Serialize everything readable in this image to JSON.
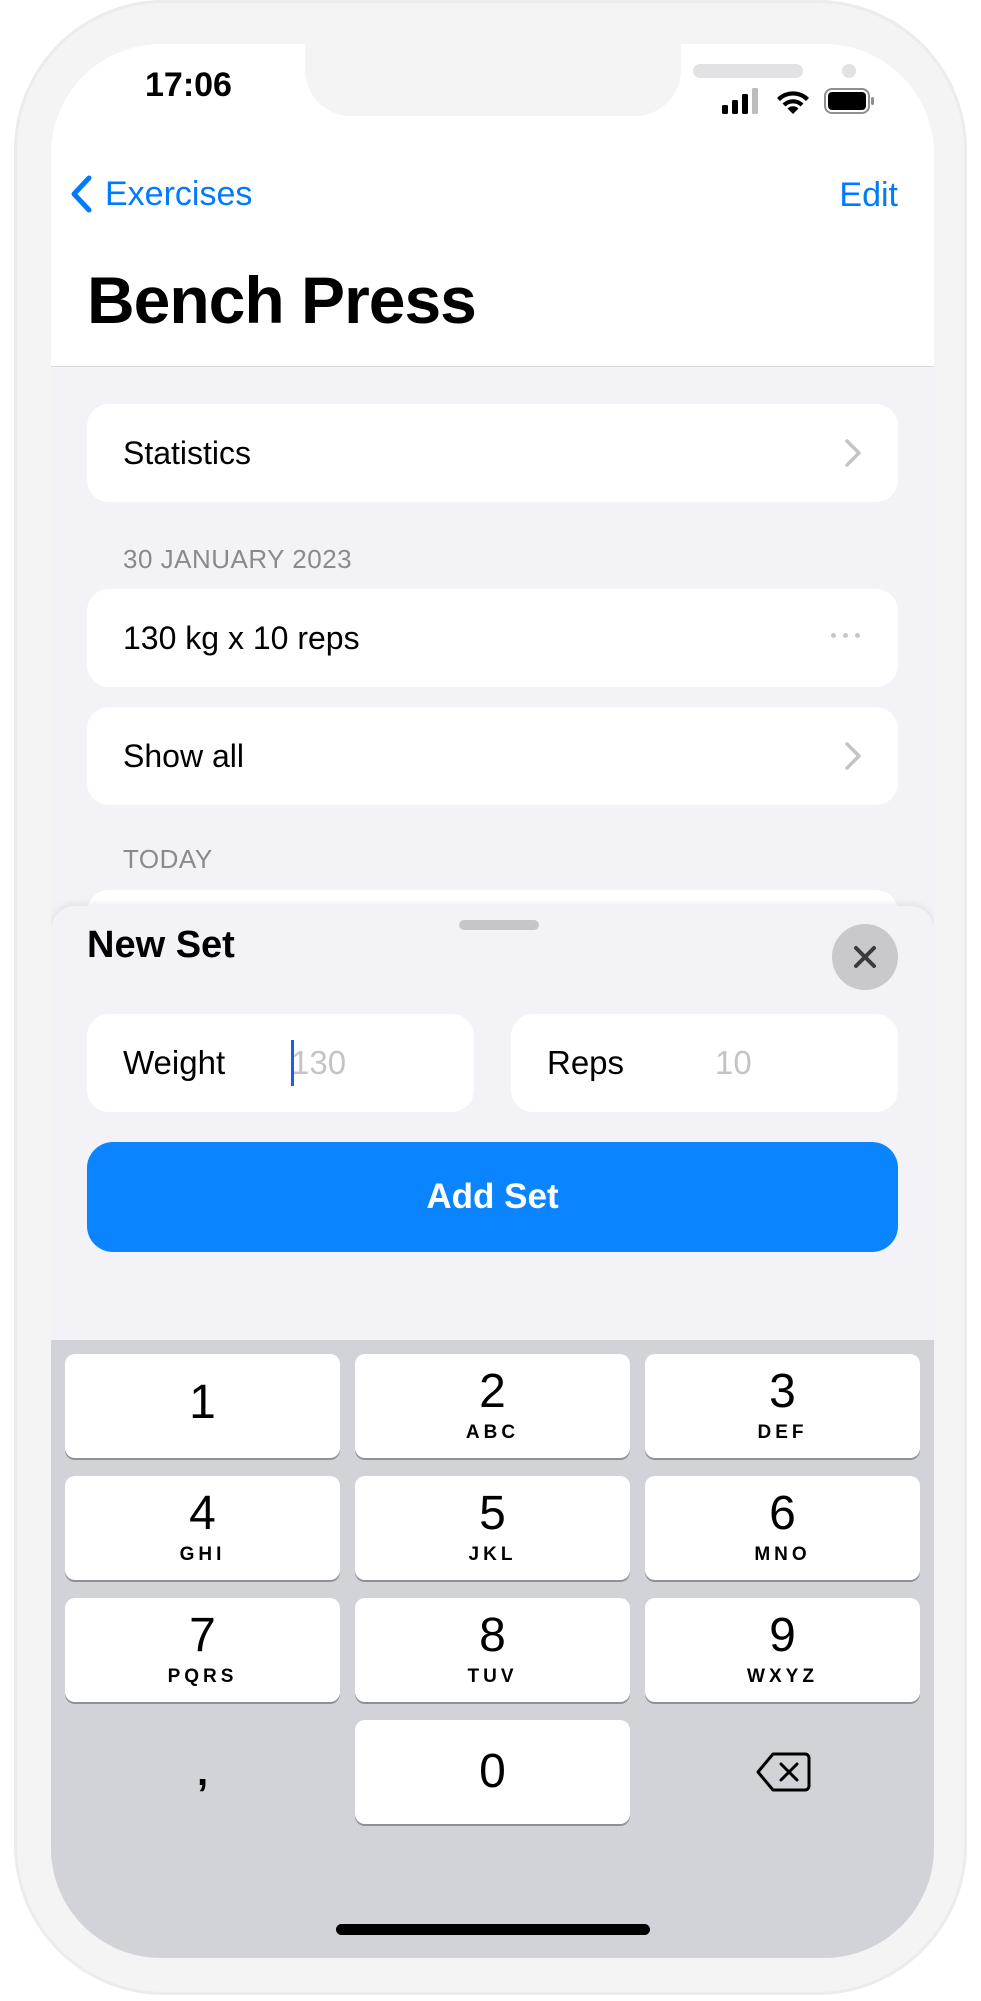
{
  "status_bar": {
    "time": "17:06"
  },
  "nav": {
    "back_label": "Exercises",
    "edit_label": "Edit",
    "title": "Bench Press"
  },
  "list": {
    "statistics_label": "Statistics",
    "history_header": "30 JANUARY 2023",
    "history_entry": "130 kg x 10 reps",
    "show_all_label": "Show all",
    "today_header": "TODAY"
  },
  "sheet": {
    "title": "New Set",
    "weight_label": "Weight",
    "weight_placeholder": "130",
    "reps_label": "Reps",
    "reps_placeholder": "10",
    "add_button_label": "Add Set"
  },
  "keyboard": {
    "keys": [
      {
        "num": "1",
        "letters": ""
      },
      {
        "num": "2",
        "letters": "ABC"
      },
      {
        "num": "3",
        "letters": "DEF"
      },
      {
        "num": "4",
        "letters": "GHI"
      },
      {
        "num": "5",
        "letters": "JKL"
      },
      {
        "num": "6",
        "letters": "MNO"
      },
      {
        "num": "7",
        "letters": "PQRS"
      },
      {
        "num": "8",
        "letters": "TUV"
      },
      {
        "num": "9",
        "letters": "WXYZ"
      },
      {
        "num": ",",
        "letters": ""
      },
      {
        "num": "0",
        "letters": ""
      }
    ],
    "delete_icon": "backspace-icon"
  },
  "colors": {
    "accent": "#007aff",
    "button": "#0a84ff",
    "background": "#f2f2f7",
    "keyboard": "#d1d3d9"
  }
}
